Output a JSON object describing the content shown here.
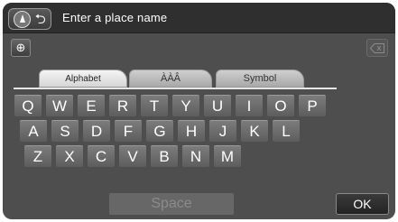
{
  "header": {
    "back_icon": "compass-back-icon",
    "prompt": "Enter a place name"
  },
  "toolbar": {
    "language_icon": "globe-icon",
    "delete_icon": "delete-icon"
  },
  "tabs": [
    {
      "label": "Alphabet",
      "active": true
    },
    {
      "label": "ÀÀÂ",
      "active": false
    },
    {
      "label": "Symbol",
      "active": false
    }
  ],
  "keyboard": {
    "row1": [
      "Q",
      "W",
      "E",
      "R",
      "T",
      "Y",
      "U",
      "I",
      "O",
      "P"
    ],
    "row2": [
      "A",
      "S",
      "D",
      "F",
      "G",
      "H",
      "J",
      "K",
      "L"
    ],
    "row3": [
      "Z",
      "X",
      "C",
      "V",
      "B",
      "N",
      "M"
    ]
  },
  "footer": {
    "space_label": "Space",
    "ok_label": "OK"
  },
  "colors": {
    "background": "#4e4e4e",
    "titlebar": "#2f2f2f",
    "key": "#6e6e6e"
  }
}
